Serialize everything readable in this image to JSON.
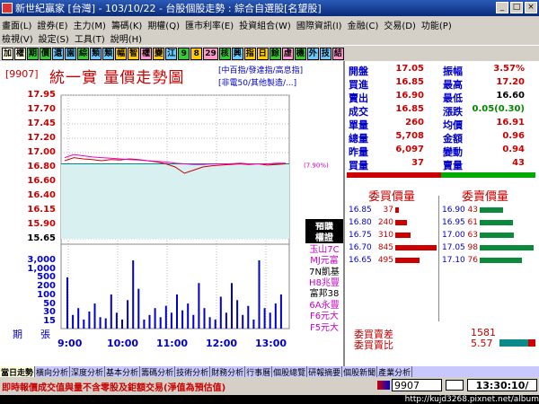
{
  "window": {
    "title": "新世紀贏家 [台灣] - 103/10/22 - 台股個股走勢 : 綜合自選股[名望股]"
  },
  "menu": {
    "row1": [
      "畫面(L)",
      "證券(E)",
      "主力(M)",
      "籌碼(K)",
      "期權(Q)",
      "匯市利率(E)",
      "投資組合(W)",
      "國際資訊(I)",
      "金融(C)",
      "交易(D)",
      "功能(P)"
    ],
    "row2": [
      "檢視(V)",
      "設定(S)",
      "工具(T)",
      "說明(H)"
    ]
  },
  "toolbar": [
    "加",
    "權",
    "期",
    "價",
    "還",
    "園",
    "綜",
    "類",
    "類",
    "幅",
    "智",
    "權",
    "變",
    "江",
    "9",
    "8",
    "29",
    "核",
    "興",
    "指",
    "日",
    "餘",
    "虛",
    "機",
    "外",
    "技",
    "結"
  ],
  "stock": {
    "code": "[9907]",
    "name": "統一實  量價走勢圖",
    "tags_line1": "[中百指/發達指/高息指]",
    "tags_line2": "[非電50/其他製造/...]"
  },
  "chart_data": {
    "type": "line",
    "price_ticks": [
      "17.95",
      "17.70",
      "17.45",
      "17.20",
      "17.00",
      "16.80",
      "16.60",
      "16.40",
      "16.15",
      "15.90",
      "15.65"
    ],
    "volume_ticks": [
      "3,000",
      "1,000",
      "500",
      "200",
      "100",
      "50",
      "30",
      "15"
    ],
    "x": [
      "9:00",
      "10:00",
      "11:00",
      "12:00",
      "13:00"
    ],
    "ref_price": 16.85,
    "ref_label": "(7.90%)",
    "price_ylim": [
      15.65,
      17.95
    ],
    "series": [
      {
        "values": [
          16.9,
          16.95,
          16.93,
          16.92,
          16.9,
          16.92,
          16.91,
          16.93,
          16.92,
          16.9,
          16.88,
          16.85,
          16.8,
          16.7,
          16.75,
          16.8,
          16.82,
          16.83,
          16.84,
          16.85,
          16.84,
          16.85,
          16.83,
          16.84,
          16.85
        ]
      },
      {
        "values": [
          16.95,
          17.0,
          16.98,
          16.96,
          16.95,
          16.94,
          16.93,
          16.92,
          16.91,
          16.9,
          16.89,
          16.88,
          16.86,
          16.85,
          16.84,
          16.84,
          16.85,
          16.85,
          16.85,
          16.86,
          16.85,
          16.85,
          16.85,
          16.86,
          16.86
        ]
      }
    ],
    "volumes": [
      45,
      12,
      18,
      8,
      15,
      22,
      10,
      9,
      30,
      14,
      8,
      25,
      60,
      35,
      8,
      12,
      18,
      10,
      20,
      14,
      30,
      16,
      22,
      12,
      40,
      18,
      10,
      8,
      28,
      14,
      40,
      25,
      12,
      20,
      8,
      60,
      18,
      14,
      22,
      30
    ]
  },
  "side_tags": [
    "預購",
    "權證",
    "玉山7C",
    "MJ元富",
    "7N凱基",
    "H8兆豐",
    "富邦38",
    "6A永豐",
    "F6元大",
    "F5元大"
  ],
  "quote": [
    {
      "l1": "開盤",
      "v1": "17.05",
      "c1": "red",
      "l2": "振幅",
      "v2": "3.57%",
      "c2": "red"
    },
    {
      "l1": "買進",
      "v1": "16.85",
      "c1": "red",
      "l2": "最高",
      "v2": "17.20",
      "c2": "red"
    },
    {
      "l1": "賣出",
      "v1": "16.90",
      "c1": "red",
      "l2": "最低",
      "v2": "16.60",
      "c2": "blk"
    },
    {
      "l1": "成交",
      "v1": "16.85",
      "c1": "red",
      "l2": "漲跌",
      "v2": "0.05(0.30)",
      "c2": "grn"
    },
    {
      "l1": "單量",
      "v1": "260",
      "c1": "red",
      "l2": "均價",
      "v2": "16.91",
      "c2": "red"
    },
    {
      "l1": "總量",
      "v1": "5,708",
      "c1": "red",
      "l2": "金額",
      "v2": "0.96",
      "c2": "red"
    },
    {
      "l1": "昨量",
      "v1": "6,097",
      "c1": "red",
      "l2": "變動",
      "v2": "0.94",
      "c2": "red"
    },
    {
      "l1": "買量",
      "v1": "37",
      "c1": "red",
      "l2": "賣量",
      "v2": "43",
      "c2": "red"
    }
  ],
  "book": {
    "bid_head": "委買價量",
    "ask_head": "委賣價量",
    "bids": [
      {
        "p": "16.85",
        "q": "37"
      },
      {
        "p": "16.80",
        "q": "240"
      },
      {
        "p": "16.75",
        "q": "310"
      },
      {
        "p": "16.70",
        "q": "845"
      },
      {
        "p": "16.65",
        "q": "495"
      }
    ],
    "asks": [
      {
        "p": "16.90",
        "q": "43"
      },
      {
        "p": "16.95",
        "q": "61"
      },
      {
        "p": "17.00",
        "q": "63"
      },
      {
        "p": "17.05",
        "q": "98"
      },
      {
        "p": "17.10",
        "q": "76"
      }
    ],
    "bid_fill": [
      0.05,
      0.28,
      0.36,
      1.0,
      0.58
    ],
    "ask_fill": [
      0.44,
      0.62,
      0.64,
      1.0,
      0.78
    ],
    "diff_label": "委買賣差",
    "diff_value": "1581",
    "ratio_label": "委買賣比",
    "ratio_value": "5.57"
  },
  "tabs": [
    "當日走勢",
    "橫向分析",
    "深度分析",
    "基本分析",
    "籌碼分析",
    "技術分析",
    "財務分析",
    "行事曆",
    "個股總覽",
    "研報摘要",
    "個股新聞",
    "產業分析"
  ],
  "status": {
    "marquee": "即時報價成交值與量不含零股及鉅額交易(淨值為預估值)",
    "code": "9907",
    "time": "13:30:10/"
  },
  "watermark": "http://kujd3268.pixnet.net/album"
}
